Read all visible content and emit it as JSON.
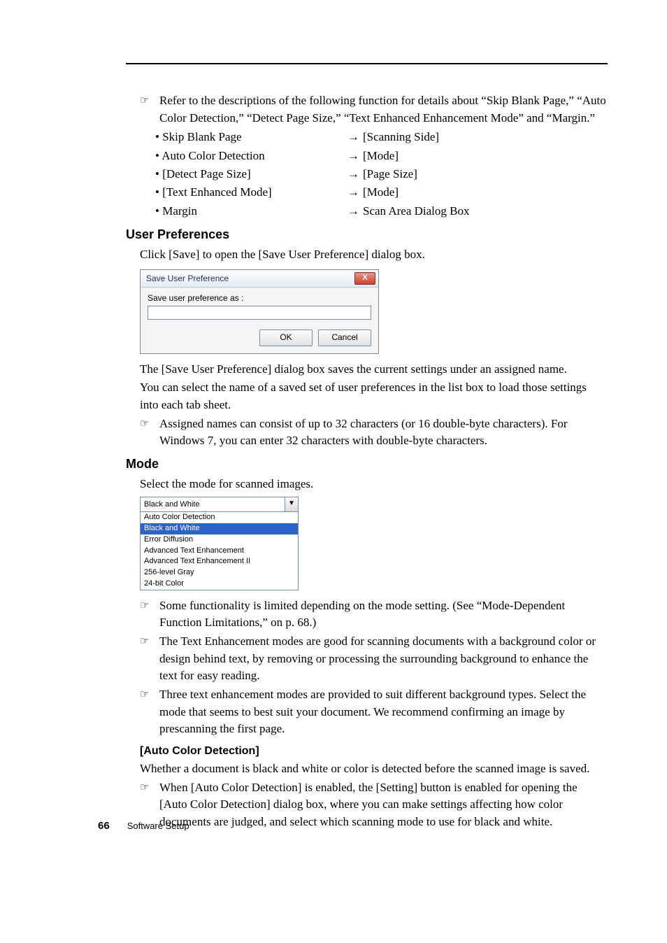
{
  "intro_note": "Refer to the descriptions of the following function for details about “Skip Blank Page,” “Auto Color Detection,” “Detect Page Size,” “Text Enhanced Enhancement Mode” and “Margin.”",
  "refs": [
    {
      "left": "• Skip Blank Page",
      "right": "[Scanning Side]"
    },
    {
      "left": "• Auto Color Detection",
      "right": "[Mode]"
    },
    {
      "left": "• [Detect Page Size]",
      "right": "[Page Size]"
    },
    {
      "left": "• [Text Enhanced Mode]",
      "right": "[Mode]"
    },
    {
      "left": "• Margin",
      "right": "Scan Area Dialog Box"
    }
  ],
  "arrow": "→",
  "h_user_preferences": "User Preferences",
  "user_pref_intro": "Click [Save] to open the [Save User Preference] dialog box.",
  "dialog": {
    "title": "Save User Preference",
    "close": "X",
    "label": "Save user preference as :",
    "ok": "OK",
    "cancel": "Cancel"
  },
  "user_pref_para1": "The [Save User Preference] dialog box saves the current settings under an assigned name.",
  "user_pref_para2": "You can select the name of a saved set of user preferences in the list box to load those settings into each tab sheet.",
  "user_pref_note": "Assigned names can consist of up to 32 characters (or 16 double-byte characters). For Windows 7, you can enter 32 characters with double-byte characters.",
  "h_mode": "Mode",
  "mode_intro": "Select the mode for scanned images.",
  "mode_cb_value": "Black and White",
  "mode_options": [
    "Auto Color Detection",
    "Black and White",
    "Error Diffusion",
    "Advanced Text Enhancement",
    "Advanced Text Enhancement II",
    "256-level Gray",
    "24-bit Color"
  ],
  "mode_selected_index": 1,
  "mode_note1": "Some functionality is limited depending on the mode setting. (See “Mode-Dependent Function Limitations,” on p. 68.)",
  "mode_note2": "The Text Enhancement modes are good for scanning documents with a background color or design behind text, by removing or processing the surrounding background to enhance the text for easy reading.",
  "mode_note3": "Three text enhancement modes are provided to suit different background types.  Select the mode that seems to best suit your document. We recommend confirming an image by prescanning the first page.",
  "h_auto_color": "[Auto Color Detection]",
  "auto_color_para": "Whether a document is black and white or color is detected before the scanned image is saved.",
  "auto_color_note": "When [Auto Color Detection] is enabled, the [Setting] button is enabled for opening the [Auto Color Detection] dialog box, where you can make settings affecting how color documents are judged, and select which scanning mode to use for black and white.",
  "footer": {
    "page": "66",
    "section": "Software Setup"
  },
  "pointer_icon": "☞"
}
